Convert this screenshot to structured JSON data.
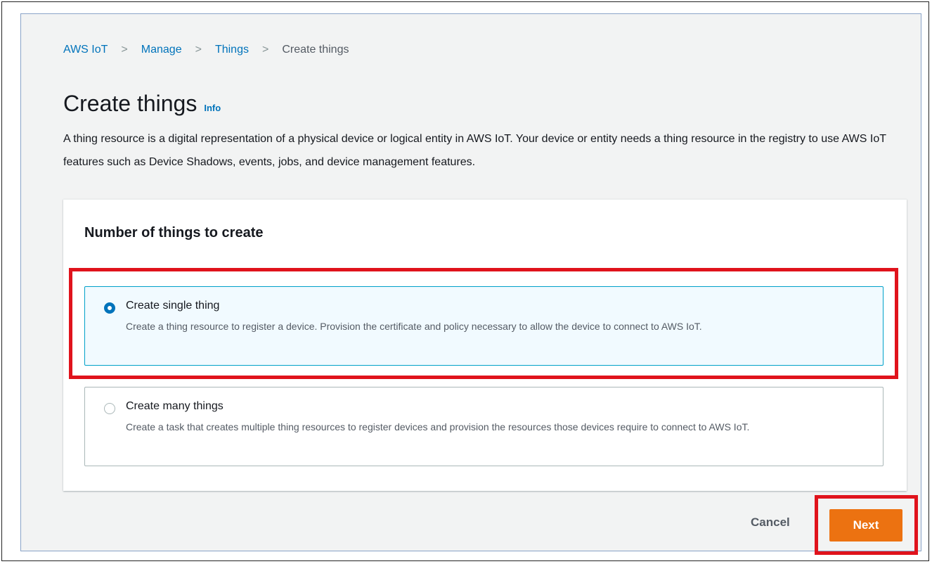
{
  "breadcrumb": {
    "items": [
      {
        "label": "AWS IoT"
      },
      {
        "label": "Manage"
      },
      {
        "label": "Things"
      }
    ],
    "current": "Create things"
  },
  "page": {
    "title": "Create things",
    "info_label": "Info",
    "description": "A thing resource is a digital representation of a physical device or logical entity in AWS IoT. Your device or entity needs a thing resource in the registry to use AWS IoT features such as Device Shadows, events, jobs, and device management features."
  },
  "panel": {
    "header": "Number of things to create",
    "options": [
      {
        "title": "Create single thing",
        "description": "Create a thing resource to register a device. Provision the certificate and policy necessary to allow the device to connect to AWS IoT.",
        "selected": true
      },
      {
        "title": "Create many things",
        "description": "Create a task that creates multiple thing resources to register devices and provision the resources those devices require to connect to AWS IoT.",
        "selected": false
      }
    ]
  },
  "actions": {
    "cancel_label": "Cancel",
    "next_label": "Next"
  },
  "colors": {
    "accent": "#0073bb",
    "primary_button": "#ec7211",
    "highlight": "#e0131c"
  }
}
